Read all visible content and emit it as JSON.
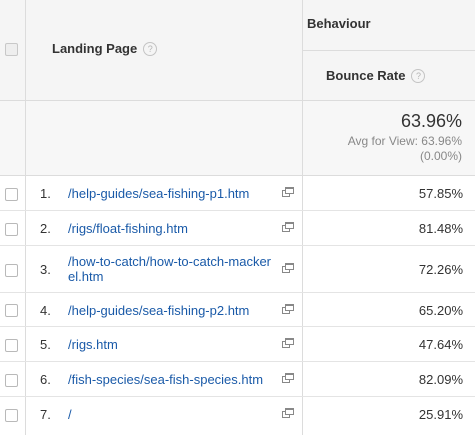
{
  "header": {
    "landing_page_label": "Landing Page",
    "help_glyph": "?",
    "behaviour_label": "Behaviour",
    "bounce_rate_label": "Bounce Rate"
  },
  "summary": {
    "total": "63.96%",
    "avg_line1": "Avg for View: 63.96%",
    "avg_line2": "(0.00%)"
  },
  "icons": {
    "open_external": "open-in-new-window-icon",
    "help": "help-icon"
  },
  "rows": [
    {
      "index": "1.",
      "page": "/help-guides/sea-fishing-p1.htm",
      "bounce": "57.85%"
    },
    {
      "index": "2.",
      "page": "/rigs/float-fishing.htm",
      "bounce": "81.48%"
    },
    {
      "index": "3.",
      "page": "/how-to-catch/how-to-catch-mackerel.htm",
      "bounce": "72.26%"
    },
    {
      "index": "4.",
      "page": "/help-guides/sea-fishing-p2.htm",
      "bounce": "65.20%"
    },
    {
      "index": "5.",
      "page": "/rigs.htm",
      "bounce": "47.64%"
    },
    {
      "index": "6.",
      "page": "/fish-species/sea-fish-species.htm",
      "bounce": "82.09%"
    },
    {
      "index": "7.",
      "page": "/",
      "bounce": "25.91%"
    }
  ]
}
